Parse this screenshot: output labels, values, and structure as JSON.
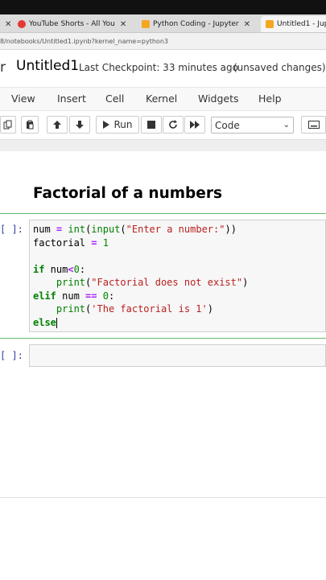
{
  "browser": {
    "tabs": [
      {
        "label": "YouTube Shorts - All You",
        "color": "#e53935"
      },
      {
        "label": "Python Coding - Jupyter",
        "color": "#f5a623"
      },
      {
        "label": "Untitled1 - Jup",
        "color": "#f5a623"
      }
    ],
    "url": "8/notebooks/Untitled1.ipynb?kernel_name=python3"
  },
  "header": {
    "logo_fragment": "r",
    "notebook_title": "Untitled1",
    "checkpoint": "Last Checkpoint: 33 minutes ago",
    "unsaved": "(unsaved changes)"
  },
  "menu": [
    "View",
    "Insert",
    "Cell",
    "Kernel",
    "Widgets",
    "Help"
  ],
  "toolbar": {
    "run_label": "Run",
    "cell_type": "Code"
  },
  "notebook": {
    "heading": "Factorial of a numbers",
    "cell1_prompt": "[ ]:",
    "cell2_prompt": "[ ]:",
    "code": {
      "l1_a": "num",
      "l1_b": "= ",
      "l1_c": "int",
      "l1_d": "(",
      "l1_e": "input",
      "l1_f": "(",
      "l1_g": "\"Enter a number:\"",
      "l1_h": "))",
      "l2_a": "factorial ",
      "l2_b": "=",
      "l2_c": " 1",
      "l4_a": "if",
      "l4_b": " num",
      "l4_c": "<",
      "l4_d": "0",
      "l4_e": ":",
      "l5_a": "print",
      "l5_b": "(",
      "l5_c": "\"Factorial does not exist\"",
      "l5_d": ")",
      "l6_a": "elif",
      "l6_b": " num ",
      "l6_c": "==",
      "l6_d": " 0",
      "l6_e": ":",
      "l7_a": "print",
      "l7_b": "(",
      "l7_c": "'The factorial is 1'",
      "l7_d": ")",
      "l8_a": "else"
    }
  }
}
